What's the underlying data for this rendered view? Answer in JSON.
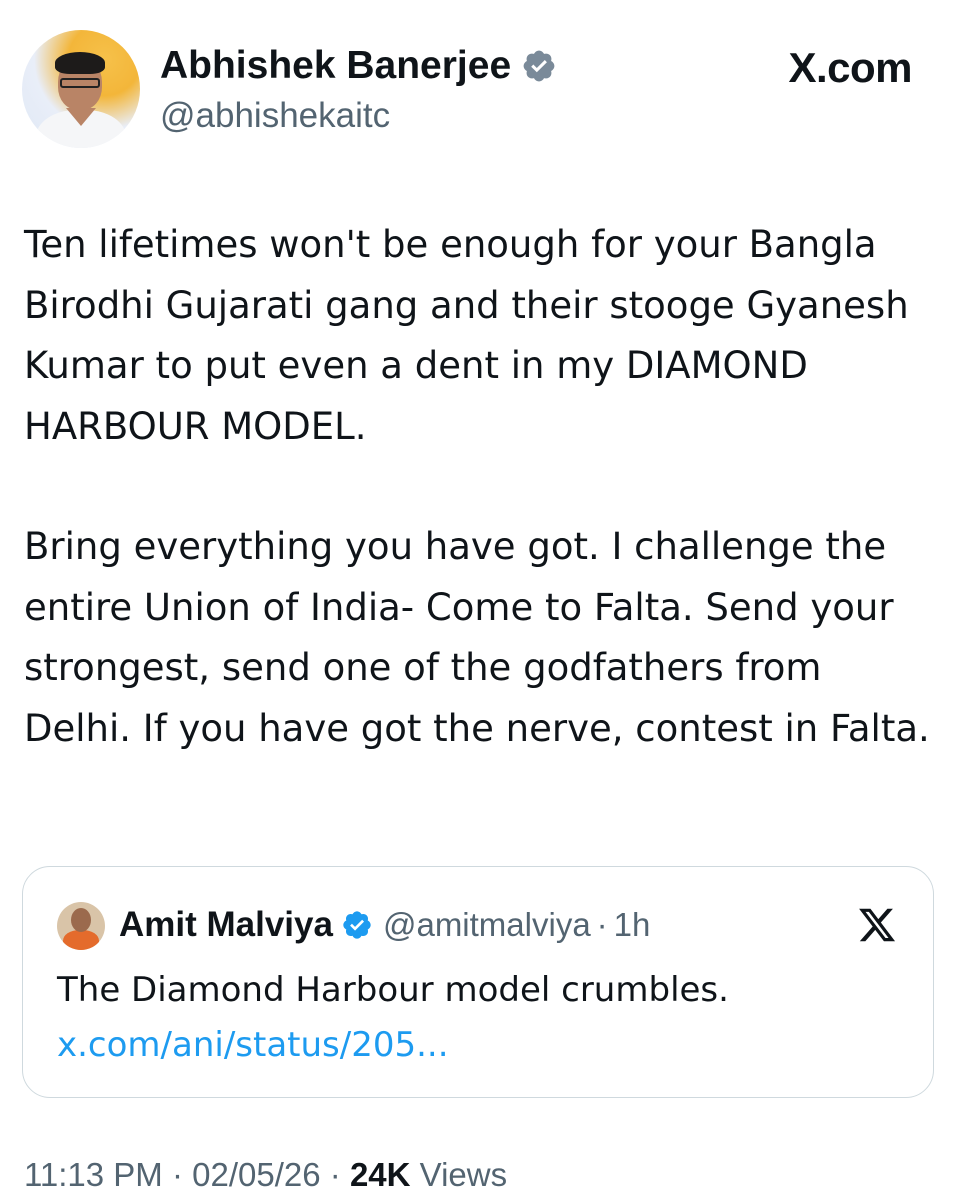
{
  "author": {
    "name": "Abhishek Banerjee",
    "handle": "@abhishekaitc",
    "verified_icon": "verified-badge-icon"
  },
  "brand": {
    "label": "X.com"
  },
  "post": {
    "paragraph_1": "Ten lifetimes won't be enough for your Bangla Birodhi Gujarati gang and their stooge Gyanesh Kumar to put even a dent in my DIAMOND HARBOUR MODEL.",
    "paragraph_2": "Bring everything you have got. I challenge the entire Union of India- Come to Falta. Send your strongest, send one of the godfathers from Delhi. If you have got the nerve, contest in Falta."
  },
  "quoted": {
    "name": "Amit Malviya",
    "handle": "@amitmalviya",
    "separator": "·",
    "time": "1h",
    "text": "The Diamond Harbour model crumbles. ",
    "link": "x.com/ani/status/205...",
    "x_icon": "x-logo-icon"
  },
  "meta": {
    "time": "11:13 PM",
    "sep1": " · ",
    "date": "02/05/26",
    "sep2": " · ",
    "views_count": "24K",
    "views_label": " Views"
  },
  "colors": {
    "text": "#0f1419",
    "secondary": "#536471",
    "link": "#1d9bf0",
    "verified_blue": "#1d9bf0",
    "verified_gray": "#7a8a99",
    "border": "#cfd9de"
  }
}
